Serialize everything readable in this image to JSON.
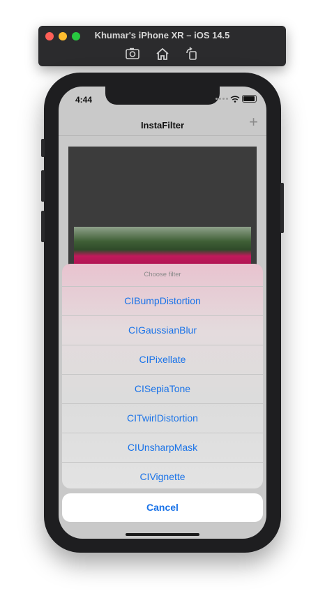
{
  "simulator": {
    "title": "Khumar's iPhone XR – iOS 14.5",
    "tools": [
      "screenshot-icon",
      "home-icon",
      "rotate-icon"
    ]
  },
  "status_bar": {
    "time": "4:44"
  },
  "nav": {
    "title": "InstaFilter",
    "add_icon": "+"
  },
  "action_sheet": {
    "title": "Choose filter",
    "items": [
      "CIBumpDistortion",
      "CIGaussianBlur",
      "CIPixellate",
      "CISepiaTone",
      "CITwirlDistortion",
      "CIUnsharpMask",
      "CIVignette"
    ],
    "cancel": "Cancel"
  },
  "colors": {
    "accent": "#1a73e8",
    "sheet_title": "#8a8a8a"
  }
}
